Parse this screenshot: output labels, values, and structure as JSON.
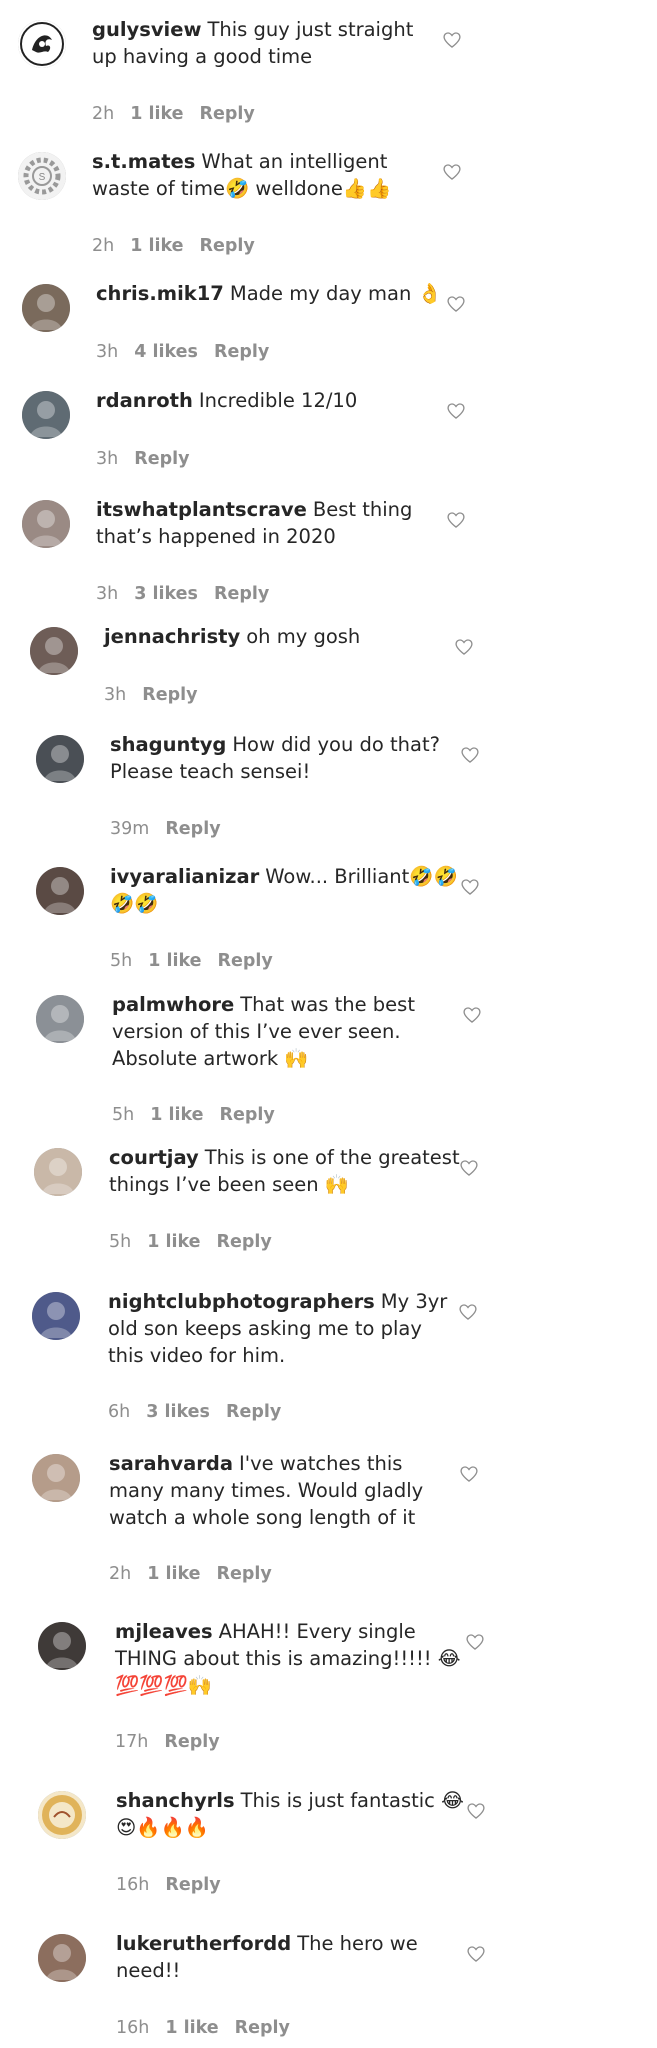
{
  "colors": {
    "text": "#262626",
    "muted": "#8e8e8e",
    "background": "#ffffff"
  },
  "icons": {
    "like": "heart-outline-icon"
  },
  "comments": [
    {
      "username": "gulysview",
      "text": "This guy just straight up having a good time",
      "time": "2h",
      "likes": "1 like",
      "reply": "Reply",
      "avatar": "dragon-sigil"
    },
    {
      "username": "s.t.mates",
      "text": "What an intelligent waste of time🤣 welldone👍👍",
      "time": "2h",
      "likes": "1 like",
      "reply": "Reply",
      "avatar": "gear-logo"
    },
    {
      "username": "chris.mik17",
      "text": "Made my day man 👌",
      "time": "3h",
      "likes": "4 likes",
      "reply": "Reply",
      "avatar": "photo"
    },
    {
      "username": "rdanroth",
      "text": "Incredible 12/10",
      "time": "3h",
      "likes": "",
      "reply": "Reply",
      "avatar": "photo"
    },
    {
      "username": "itswhatplantscrave",
      "text": "Best thing that’s happened in 2020",
      "time": "3h",
      "likes": "3 likes",
      "reply": "Reply",
      "avatar": "photo"
    },
    {
      "username": "jennachristy",
      "text": "oh my gosh",
      "time": "3h",
      "likes": "",
      "reply": "Reply",
      "avatar": "photo"
    },
    {
      "username": "shaguntyg",
      "text": "How did you do that? Please teach sensei!",
      "time": "39m",
      "likes": "",
      "reply": "Reply",
      "avatar": "photo"
    },
    {
      "username": "ivyaralianizar",
      "text": "Wow... Brilliant🤣🤣 🤣🤣",
      "time": "5h",
      "likes": "1 like",
      "reply": "Reply",
      "avatar": "photo"
    },
    {
      "username": "palmwhore",
      "text": "That was the best version of this I’ve ever seen. Absolute artwork 🙌",
      "time": "5h",
      "likes": "1 like",
      "reply": "Reply",
      "avatar": "photo"
    },
    {
      "username": "courtjay",
      "text": "This is one of the greatest things I’ve been seen 🙌",
      "time": "5h",
      "likes": "1 like",
      "reply": "Reply",
      "avatar": "photo"
    },
    {
      "username": "nightclubphotographers",
      "text": "My 3yr old son keeps asking me to play this video for him.",
      "time": "6h",
      "likes": "3 likes",
      "reply": "Reply",
      "avatar": "photo"
    },
    {
      "username": "sarahvarda",
      "text": "I've watches this many many times. Would gladly watch a whole song length of it",
      "time": "2h",
      "likes": "1 like",
      "reply": "Reply",
      "avatar": "photo"
    },
    {
      "username": "mjleaves",
      "text": "AHAH!! Every single THING about this is amazing!!!!! 😂💯💯💯🙌",
      "time": "17h",
      "likes": "",
      "reply": "Reply",
      "avatar": "photo"
    },
    {
      "username": "shanchyrls",
      "text": "This is just fantastic 😂 😍🔥🔥🔥",
      "time": "16h",
      "likes": "",
      "reply": "Reply",
      "avatar": "logo"
    },
    {
      "username": "lukerutherfordd",
      "text": "The hero we need!!",
      "time": "16h",
      "likes": "1 like",
      "reply": "Reply",
      "avatar": "photo"
    }
  ]
}
